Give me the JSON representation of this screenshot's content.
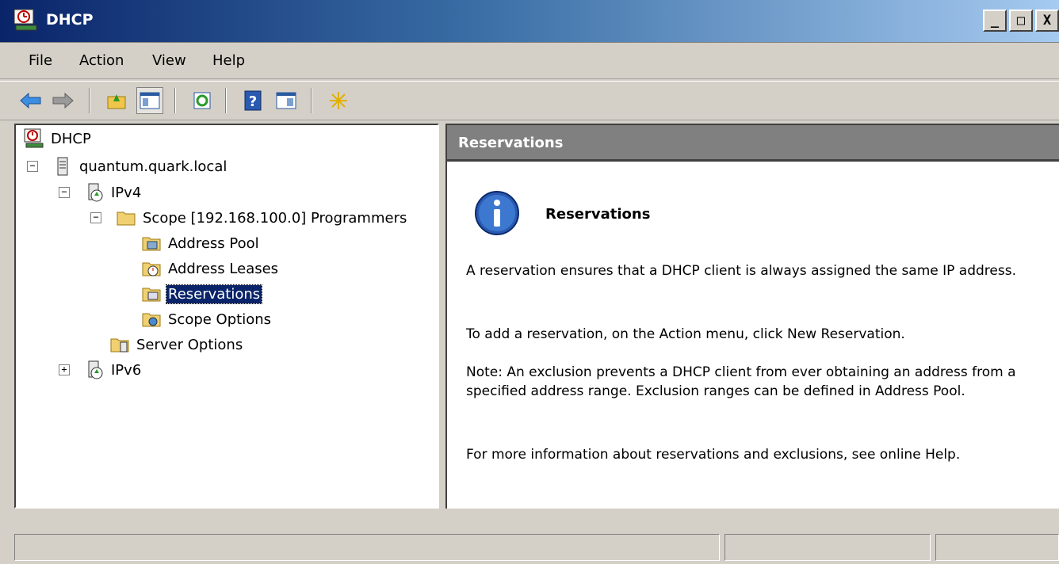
{
  "window": {
    "title": "DHCP",
    "icon": "dhcp-icon",
    "controls": {
      "minimize": "_",
      "maximize": "□",
      "close": "X"
    }
  },
  "menu": {
    "items": [
      {
        "label": "File",
        "accel": "F"
      },
      {
        "label": "Action",
        "accel": "A"
      },
      {
        "label": "View",
        "accel": "V"
      },
      {
        "label": "Help",
        "accel": "H"
      }
    ]
  },
  "toolbar": {
    "buttons": [
      "back-icon",
      "forward-icon",
      "up-folder-icon",
      "show-hide-tree-icon",
      "refresh-icon",
      "help-icon",
      "action-pane-icon",
      "new-icon"
    ]
  },
  "tree": {
    "nodes": [
      {
        "label": "DHCP",
        "icon": "dhcp-icon",
        "expander": ""
      },
      {
        "label": "quantum.quark.local",
        "icon": "server-icon",
        "expander": "−"
      },
      {
        "label": "IPv4",
        "icon": "ipv4-icon",
        "expander": "−"
      },
      {
        "label": "Scope [192.168.100.0] Programmers",
        "icon": "folder-icon",
        "expander": "−"
      },
      {
        "label": "Address Pool",
        "icon": "address-pool-icon",
        "expander": ""
      },
      {
        "label": "Address Leases",
        "icon": "address-leases-icon",
        "expander": ""
      },
      {
        "label": "Reservations",
        "icon": "reservations-icon",
        "expander": "",
        "selected": true
      },
      {
        "label": "Scope Options",
        "icon": "scope-options-icon",
        "expander": ""
      },
      {
        "label": "Server Options",
        "icon": "server-options-icon",
        "expander": ""
      },
      {
        "label": "IPv6",
        "icon": "ipv6-icon",
        "expander": "+"
      }
    ]
  },
  "details": {
    "header": "Reservations",
    "title": "Reservations",
    "paragraphs": [
      "A reservation ensures that a DHCP client is always assigned the same IP address.",
      "To add a reservation, on the Action menu, click New Reservation.",
      "Note: An exclusion prevents a DHCP client from ever obtaining an address from a specified address range.  Exclusion ranges can be defined in Address Pool.",
      "For more information about reservations and exclusions, see online Help."
    ]
  },
  "colors": {
    "title_gradient_start": "#0a246a",
    "title_gradient_end": "#a6caf0",
    "selection": "#0a246a",
    "header_gray": "#808080",
    "chrome": "#d4d0c8"
  }
}
